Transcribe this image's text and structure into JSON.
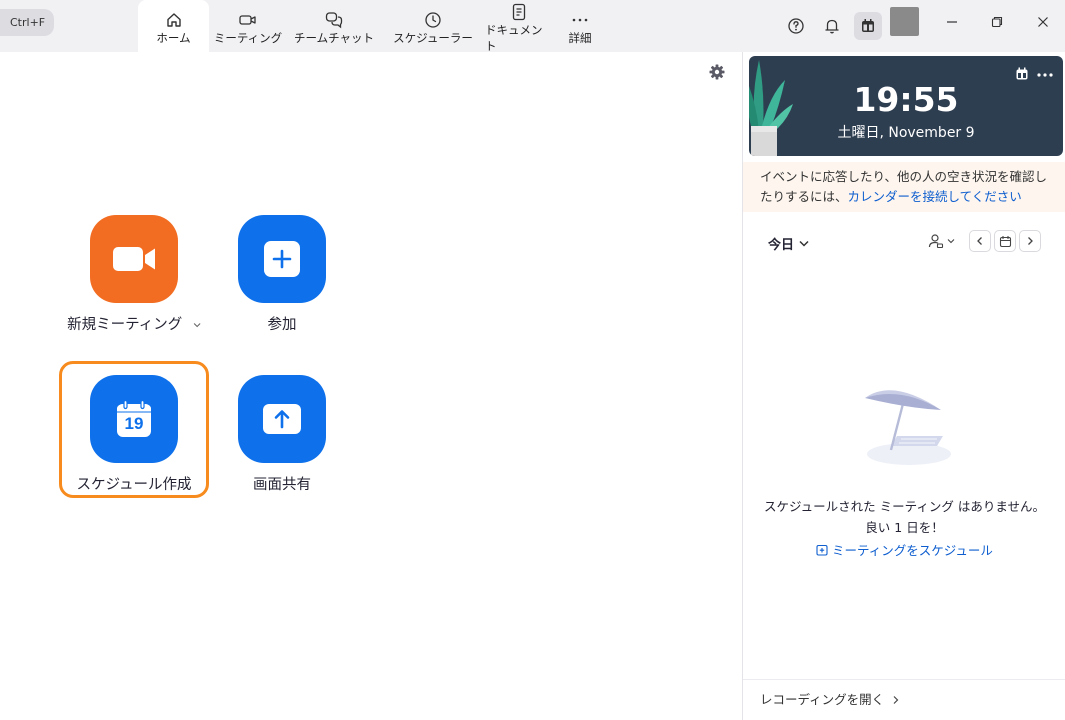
{
  "search": {
    "shortcut": "Ctrl+F"
  },
  "tabs": [
    {
      "label": "ホーム",
      "icon": "home-icon",
      "active": true
    },
    {
      "label": "ミーティング",
      "icon": "video-camera-icon"
    },
    {
      "label": "チームチャット",
      "icon": "chat-bubbles-icon"
    },
    {
      "label": "スケジューラー",
      "icon": "clock-icon"
    },
    {
      "label": "ドキュメント",
      "icon": "document-icon"
    },
    {
      "label": "詳細",
      "icon": "more-dots-icon"
    }
  ],
  "toolbar_icons": [
    "help-icon",
    "bell-icon",
    "calendar-widget-icon",
    "avatar",
    "minimize-icon",
    "restore-icon",
    "close-icon"
  ],
  "actions": {
    "new_meeting": "新規ミーティング",
    "join": "参加",
    "schedule": "スケジュール作成",
    "share_screen": "画面共有",
    "schedule_day": "19"
  },
  "clock": {
    "time": "19:55",
    "date": "土曜日, November 9"
  },
  "notice": {
    "text": "イベントに応答したり、他の人の空き状況を確認したりするには、",
    "link": "カレンダーを接続してください"
  },
  "calendar": {
    "today_label": "今日"
  },
  "empty_state": {
    "line1": "スケジュールされた ミーティング はありません。",
    "line2": "良い 1 日を！",
    "link": "ミーティングをスケジュール"
  },
  "recording_link": "レコーディングを開く",
  "colors": {
    "orange": "#f26d21",
    "blue": "#0e71eb",
    "highlight": "#f78b1d",
    "clock_bg": "#2e3e51"
  }
}
